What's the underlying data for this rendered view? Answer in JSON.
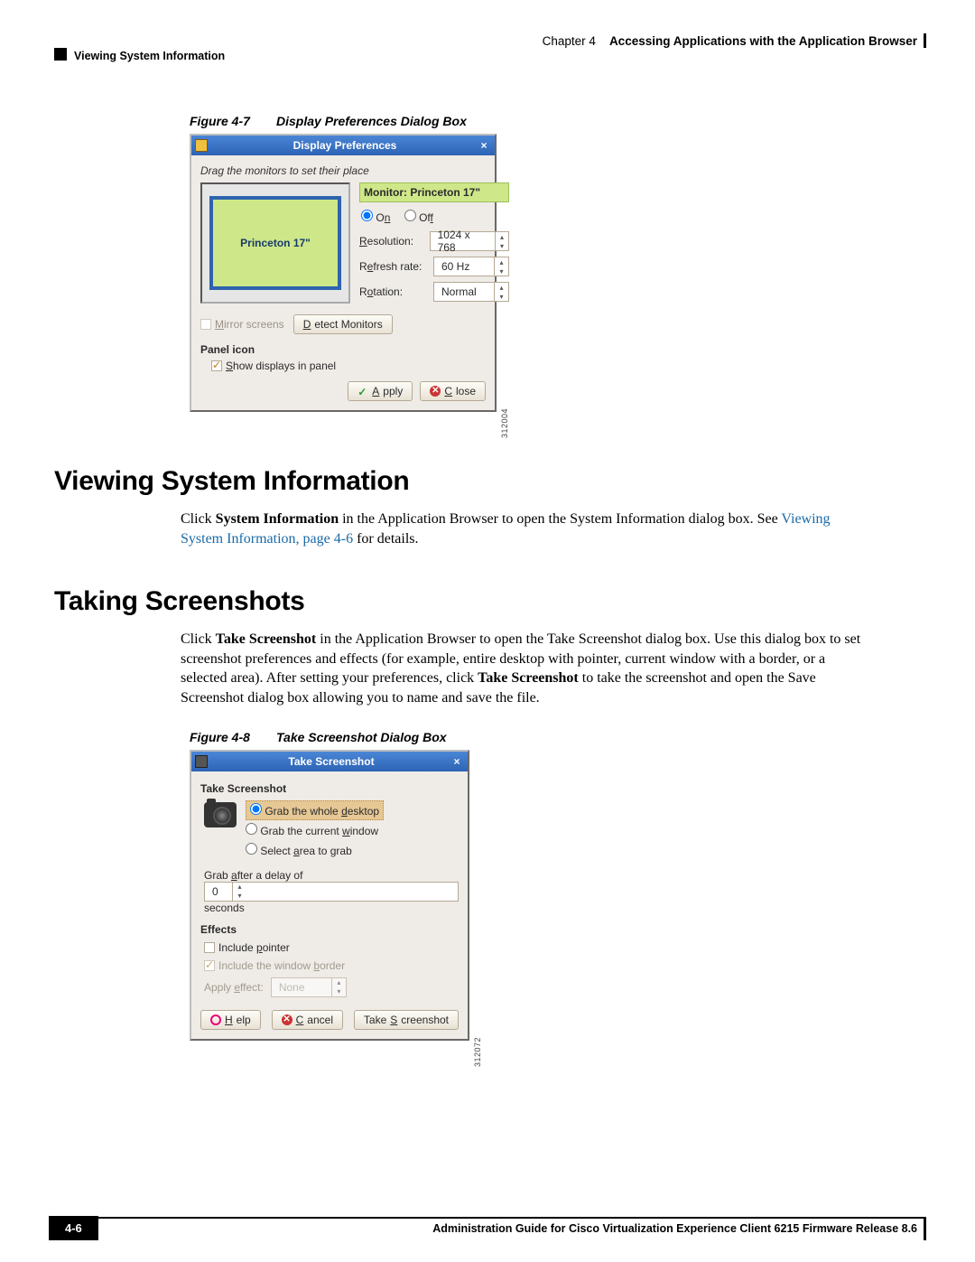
{
  "header": {
    "chapter_label": "Chapter 4",
    "chapter_title": "Accessing Applications with the Application Browser",
    "section_running": "Viewing System Information"
  },
  "fig7": {
    "num": "Figure 4-7",
    "title": "Display Preferences Dialog Box",
    "dialog_title": "Display Preferences",
    "drag_hint": "Drag the monitors to set their place",
    "monitor_box_label": "Princeton 17\"",
    "monitor_header": "Monitor: Princeton 17\"",
    "on": "On",
    "off": "Off",
    "resolution_label": "Resolution:",
    "resolution_value": "1024 x 768",
    "refresh_label": "Refresh rate:",
    "refresh_value": "60 Hz",
    "rotation_label": "Rotation:",
    "rotation_value": "Normal",
    "mirror": "Mirror screens",
    "detect": "Detect Monitors",
    "panel_icon": "Panel icon",
    "show_panel": "Show displays in panel",
    "apply": "Apply",
    "close": "Close",
    "img_id": "312004"
  },
  "sec1": {
    "heading": "Viewing System Information",
    "p1_a": "Click ",
    "p1_b": "System Information",
    "p1_c": " in the Application Browser to open the System Information dialog box. See ",
    "link": "Viewing System Information, page 4-6",
    "p1_d": " for details."
  },
  "sec2": {
    "heading": "Taking Screenshots",
    "p1_a": "Click ",
    "p1_b": "Take Screenshot",
    "p1_c": " in the Application Browser to open the Take Screenshot dialog box. Use this dialog box to set screenshot preferences and effects (for example, entire desktop with pointer, current window with a border, or a selected area). After setting your preferences, click ",
    "p1_d": "Take Screenshot",
    "p1_e": " to take the screenshot and open the Save Screenshot dialog box allowing you to name and save the file."
  },
  "fig8": {
    "num": "Figure 4-8",
    "title": "Take Screenshot Dialog Box",
    "dialog_title": "Take Screenshot",
    "section": "Take Screenshot",
    "opt1": "Grab the whole desktop",
    "opt2": "Grab the current window",
    "opt3": "Select area to grab",
    "delay_a": "Grab after a delay of",
    "delay_val": "0",
    "delay_b": "seconds",
    "effects": "Effects",
    "include_pointer": "Include pointer",
    "include_border": "Include the window border",
    "apply_effect": "Apply effect:",
    "apply_effect_val": "None",
    "help": "Help",
    "cancel": "Cancel",
    "take": "Take Screenshot",
    "img_id": "312072"
  },
  "footer": {
    "title": "Administration Guide for Cisco Virtualization Experience Client 6215 Firmware Release 8.6",
    "page": "4-6"
  }
}
